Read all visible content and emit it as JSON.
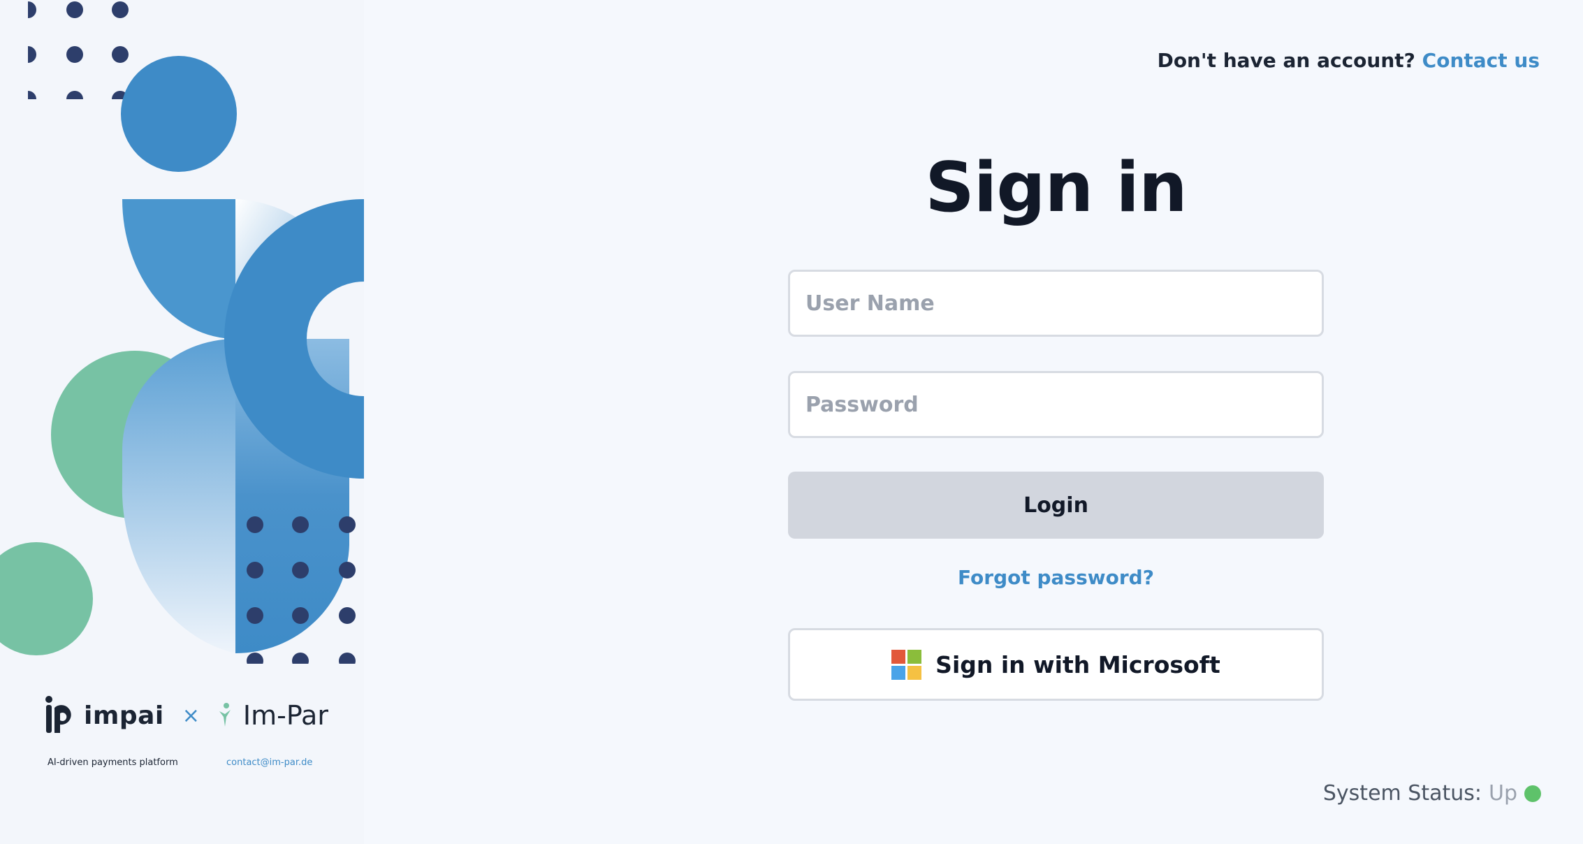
{
  "brand": {
    "impai_name": "impai",
    "separator": "×",
    "impar_name": "Im-Par",
    "tagline": "AI-driven payments platform",
    "contact_email": "contact@im-par.de"
  },
  "header": {
    "prompt": "Don't have an account?",
    "contact_link": "Contact us"
  },
  "form": {
    "title": "Sign in",
    "username": {
      "placeholder": "User Name",
      "value": ""
    },
    "password": {
      "placeholder": "Password",
      "value": ""
    },
    "login_label": "Login",
    "forgot_label": "Forgot password?",
    "microsoft_label": "Sign in with Microsoft"
  },
  "status": {
    "label": "System Status:",
    "value": "Up",
    "indicator_color": "#5ec26a"
  },
  "colors": {
    "accent": "#3e8bc7",
    "green_shape": "#77c2a4",
    "dot_navy": "#2d3e6b",
    "microsoft": [
      "#f25022",
      "#7fba00",
      "#00a4ef",
      "#ffb900"
    ]
  },
  "icons": [
    "windows-logo-icon",
    "impai-logo-icon",
    "impar-logo-icon",
    "status-dot-icon"
  ]
}
